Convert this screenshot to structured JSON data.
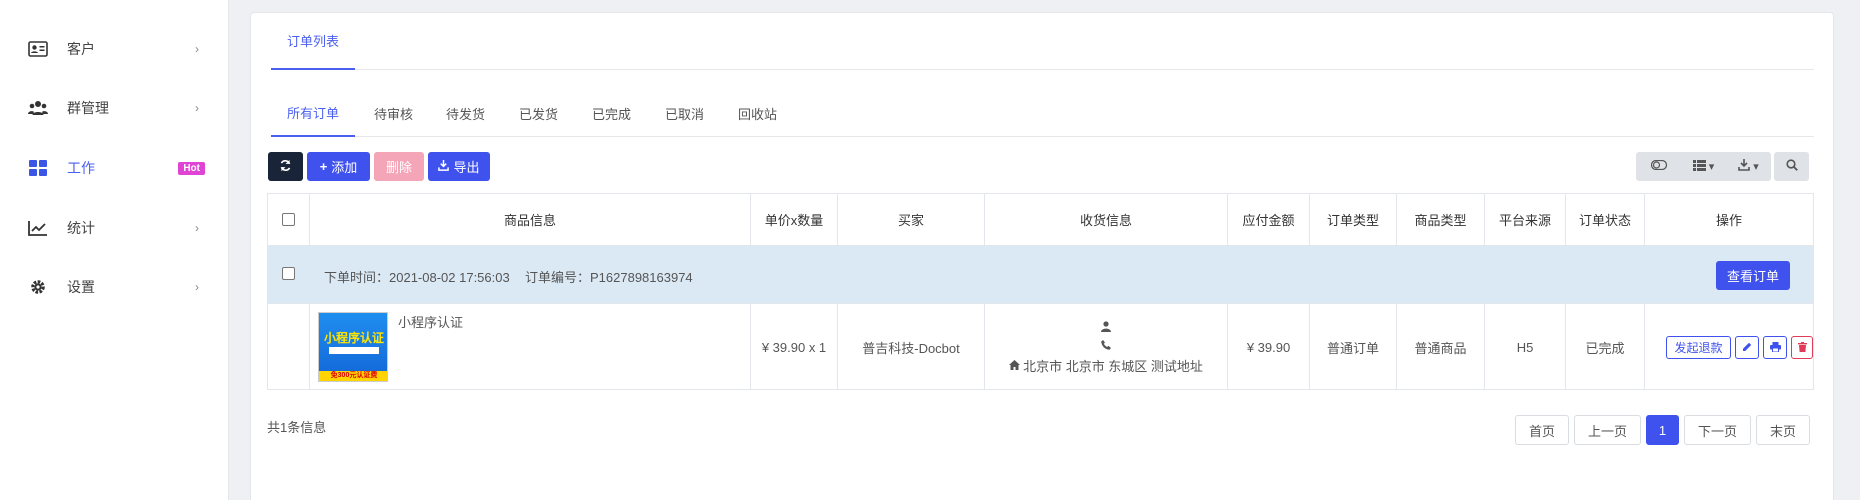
{
  "sidebar": {
    "items": [
      {
        "label": "客户",
        "icon": "contact-card-icon"
      },
      {
        "label": "群管理",
        "icon": "users-icon"
      },
      {
        "label": "工作",
        "icon": "dashboard-grid-icon",
        "badge": "Hot"
      },
      {
        "label": "统计",
        "icon": "line-chart-icon"
      },
      {
        "label": "设置",
        "icon": "gear-icon"
      }
    ],
    "chevron": "›"
  },
  "tabs_top": {
    "label": "订单列表"
  },
  "tabs_sub": [
    "所有订单",
    "待审核",
    "待发货",
    "已发货",
    "已完成",
    "已取消",
    "回收站"
  ],
  "toolbar": {
    "add_label": "添加",
    "delete_label": "删除",
    "export_label": "导出"
  },
  "table": {
    "headers": [
      "商品信息",
      "单价x数量",
      "买家",
      "收货信息",
      "应付金额",
      "订单类型",
      "商品类型",
      "平台来源",
      "订单状态",
      "操作"
    ],
    "order": {
      "time_label": "下单时间：2021-08-02 17:56:03",
      "number_label": "订单编号：P1627898163974",
      "view_button": "查看订单",
      "product_name": "小程序认证",
      "thumb_title": "小程序认证",
      "thumb_footer": "免300元认证费",
      "price_qty": "¥ 39.90 x 1",
      "buyer": "普吉科技-Docbot",
      "address": "北京市 北京市 东城区 测试地址",
      "amount": "¥ 39.90",
      "order_type": "普通订单",
      "goods_type": "普通商品",
      "platform": "H5",
      "status": "已完成",
      "refund_button": "发起退款"
    }
  },
  "footer": {
    "total": "共1条信息",
    "pagination": [
      "首页",
      "上一页",
      "1",
      "下一页",
      "末页"
    ]
  },
  "colors": {
    "accent": "#4052ee",
    "dark": "#1a2438",
    "danger": "#e03c5a",
    "hot": "#e044d4",
    "row_highlight": "#dbe9f5"
  }
}
